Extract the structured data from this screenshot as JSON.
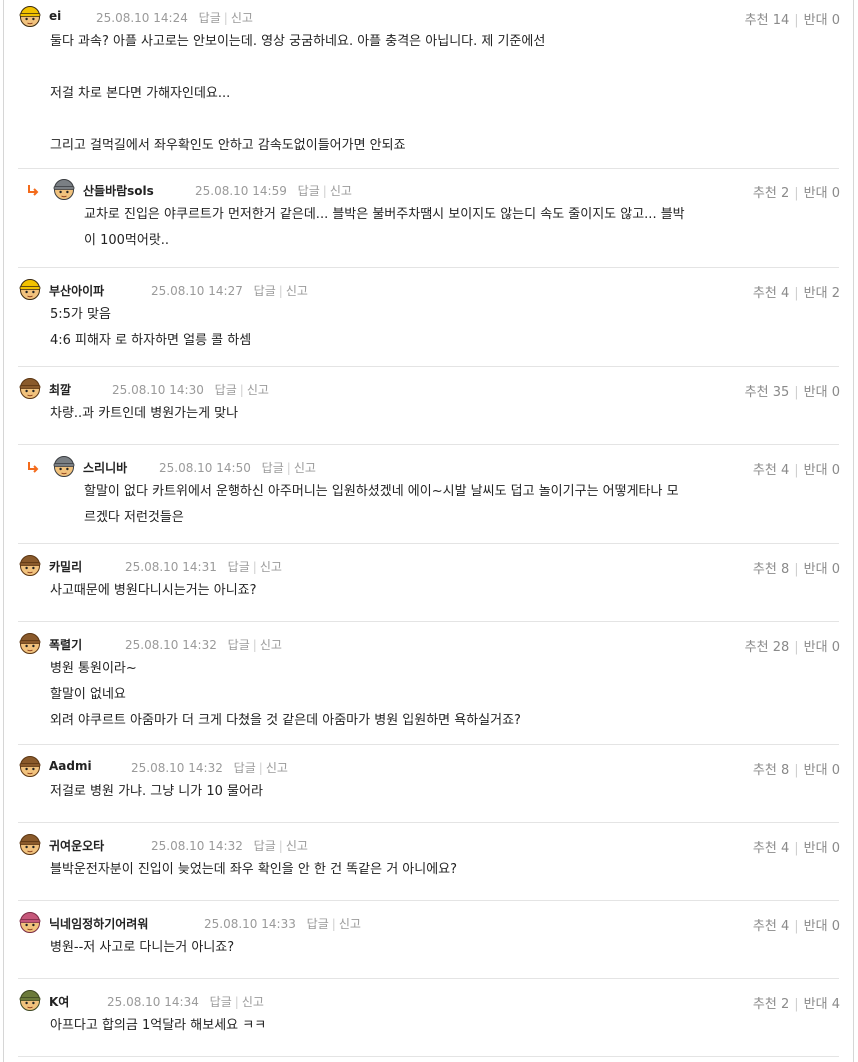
{
  "labels": {
    "reply": "답글",
    "report": "신고",
    "up": "추천",
    "down": "반대"
  },
  "colors": {
    "reply_arrow": "#f36b1c",
    "separator": "#e4e4e4",
    "meta": "#9a9a9a"
  },
  "comments": [
    {
      "nick": "ei",
      "date": "25.08.10 14:24",
      "up": "14",
      "down": "0",
      "reply": false,
      "avatar": "avatar-helmet-yellow",
      "lines": [
        "둘다 과속? 아플 사고로는 안보이는데. 영상 궁굼하네요. 아플 충격은 아닙니다. 제 기준에선",
        "",
        "저걸 차로 본다면 가해자인데요...",
        "",
        "그리고 걸먹길에서 좌우확인도 안하고 감속도없이들어가면 안되죠"
      ]
    },
    {
      "nick": "산들바람sols",
      "date": "25.08.10 14:59",
      "up": "2",
      "down": "0",
      "reply": true,
      "avatar": "avatar-helmet-gray",
      "lines": [
        "교차로 진입은 야쿠르트가 먼저한거 같은데... 블박은 불버주차땜시 보이지도 않는디 속도 줄이지도 않고... 블박",
        "이 100먹어랏.."
      ]
    },
    {
      "nick": "부산아이파",
      "date": "25.08.10 14:27",
      "up": "4",
      "down": "2",
      "reply": false,
      "avatar": "avatar-helmet-yellow",
      "lines": [
        "5:5가 맞음",
        "4:6 피해자 로 하자하면 얼릉 콜 하셈"
      ]
    },
    {
      "nick": "최깔",
      "date": "25.08.10 14:30",
      "up": "35",
      "down": "0",
      "reply": false,
      "avatar": "avatar-hair-brown",
      "lines": [
        "차량..과 카트인데 병원가는게 맞나"
      ]
    },
    {
      "nick": "스리니바",
      "date": "25.08.10 14:50",
      "up": "4",
      "down": "0",
      "reply": true,
      "avatar": "avatar-helmet-gray",
      "lines": [
        "할말이 없다 카트위에서 운행하신 아주머니는 입원하셨겠네 에이~시발 날씨도 덥고 놀이기구는 어떻게타나 모",
        "르겠다 저런것들은"
      ]
    },
    {
      "nick": "카밀리",
      "date": "25.08.10 14:31",
      "up": "8",
      "down": "0",
      "reply": false,
      "avatar": "avatar-hair-brown",
      "lines": [
        "사고때문에 병원다니시는거는 아니죠?"
      ]
    },
    {
      "nick": "폭렬기",
      "date": "25.08.10 14:32",
      "up": "28",
      "down": "0",
      "reply": false,
      "avatar": "avatar-hair-brown",
      "lines": [
        "병원 통원이라~",
        "할말이 없네요",
        "외려 야쿠르트 아줌마가 더 크게 다쳤을 것 같은데 아줌마가 병원 입원하면 욕하실거죠?"
      ]
    },
    {
      "nick": "Aadmi",
      "date": "25.08.10 14:32",
      "up": "8",
      "down": "0",
      "reply": false,
      "avatar": "avatar-hair-brown",
      "lines": [
        "저걸로 병원 가냐. 그냥 니가 10 물어라"
      ]
    },
    {
      "nick": "귀여운오타",
      "date": "25.08.10 14:32",
      "up": "4",
      "down": "0",
      "reply": false,
      "avatar": "avatar-hair-brown",
      "lines": [
        "블박운전자분이 진입이 늦었는데 좌우 확인을 안 한 건 똑같은 거 아니에요?"
      ]
    },
    {
      "nick": "닉네임정하기어려워",
      "date": "25.08.10 14:33",
      "up": "4",
      "down": "0",
      "reply": false,
      "avatar": "avatar-hair-pink",
      "lines": [
        "병원--저 사고로 다니는거 아니죠?"
      ]
    },
    {
      "nick": "K여",
      "date": "25.08.10 14:34",
      "up": "2",
      "down": "4",
      "reply": false,
      "avatar": "avatar-helmet-green",
      "lines": [
        "아프다고 합의금 1억달라 해보세요 ㅋㅋ"
      ]
    }
  ]
}
